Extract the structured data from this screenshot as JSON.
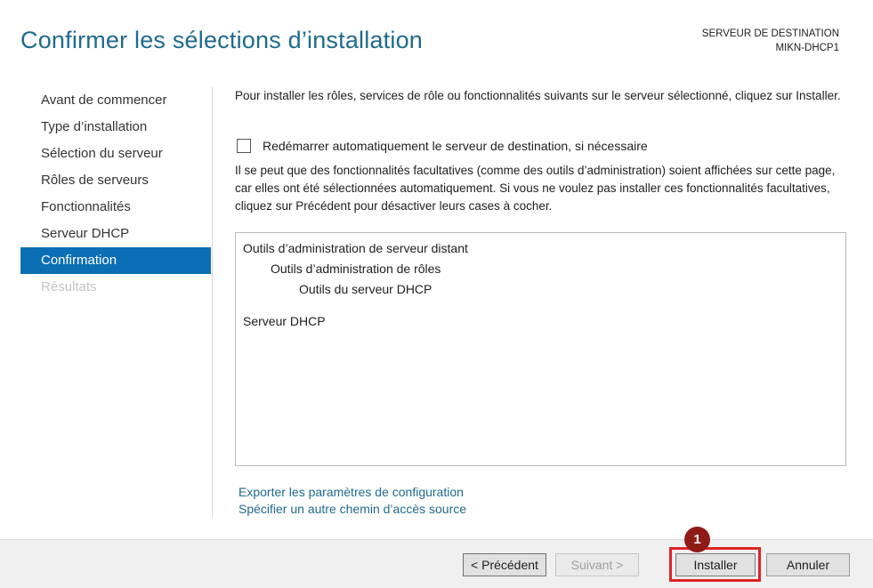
{
  "header": {
    "title": "Confirmer les sélections d’installation",
    "destination_label": "SERVEUR DE DESTINATION",
    "destination_server": "MIKN-DHCP1"
  },
  "nav": {
    "items": [
      {
        "label": "Avant de commencer",
        "state": "normal"
      },
      {
        "label": "Type d’installation",
        "state": "normal"
      },
      {
        "label": "Sélection du serveur",
        "state": "normal"
      },
      {
        "label": "Rôles de serveurs",
        "state": "normal"
      },
      {
        "label": "Fonctionnalités",
        "state": "normal"
      },
      {
        "label": "Serveur DHCP",
        "state": "normal"
      },
      {
        "label": "Confirmation",
        "state": "active"
      },
      {
        "label": "Résultats",
        "state": "disabled"
      }
    ]
  },
  "content": {
    "intro": "Pour installer les rôles, services de rôle ou fonctionnalités suivants sur le serveur sélectionné, cliquez sur Installer.",
    "restart_checkbox": {
      "label": "Redémarrer automatiquement le serveur de destination, si nécessaire",
      "checked": false
    },
    "note": "Il se peut que des fonctionnalités facultatives (comme des outils d’administration) soient affichées sur cette page, car elles ont été sélectionnées automatiquement. Si vous ne voulez pas installer ces fonctionnalités facultatives, cliquez sur Précédent pour désactiver leurs cases à cocher.",
    "features": [
      {
        "label": "Outils d’administration de serveur distant",
        "level": 0
      },
      {
        "label": "Outils d’administration de rôles",
        "level": 1
      },
      {
        "label": "Outils du serveur DHCP",
        "level": 2
      },
      {
        "label": "Serveur DHCP",
        "level": 0
      }
    ],
    "links": {
      "export": "Exporter les paramètres de configuration",
      "alt_source": "Spécifier un autre chemin d’accès source"
    }
  },
  "footer": {
    "prev": "< Précédent",
    "next": "Suivant >",
    "install": "Installer",
    "cancel": "Annuler"
  },
  "annotation": {
    "badge": "1"
  },
  "colors": {
    "accent": "#0c6fb5",
    "title": "#1f6a8c",
    "highlight": "#e02424",
    "badge": "#8f1b17"
  }
}
